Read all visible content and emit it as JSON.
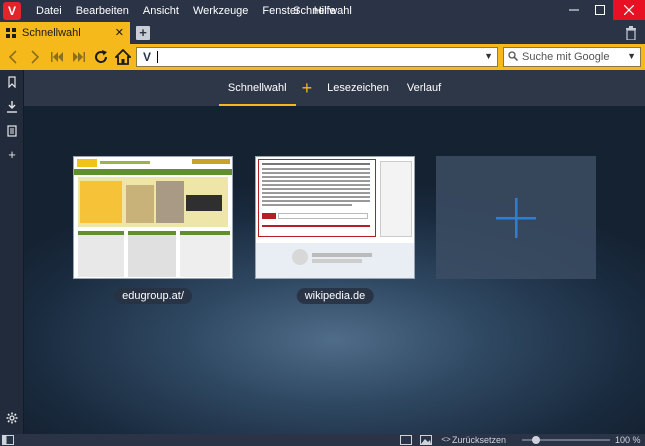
{
  "window": {
    "title": "Schnellwahl"
  },
  "menu": [
    "Datei",
    "Bearbeiten",
    "Ansicht",
    "Werkzeuge",
    "Fenster",
    "Hilfe"
  ],
  "tab": {
    "label": "Schnellwahl"
  },
  "address": {
    "value": ""
  },
  "search": {
    "placeholder": "Suche mit Google"
  },
  "subnav": {
    "speeddial": "Schnellwahl",
    "bookmarks": "Lesezeichen",
    "history": "Verlauf"
  },
  "dials": [
    {
      "label": "edugroup.at/"
    },
    {
      "label": "wikipedia.de"
    }
  ],
  "status": {
    "reset": "Zurücksetzen",
    "zoom": "100 %",
    "zoom_level": 1.0
  },
  "colors": {
    "accent": "#f6b91c",
    "close": "#e81123",
    "logo": "#e2242b",
    "add": "#2d7fd3"
  }
}
